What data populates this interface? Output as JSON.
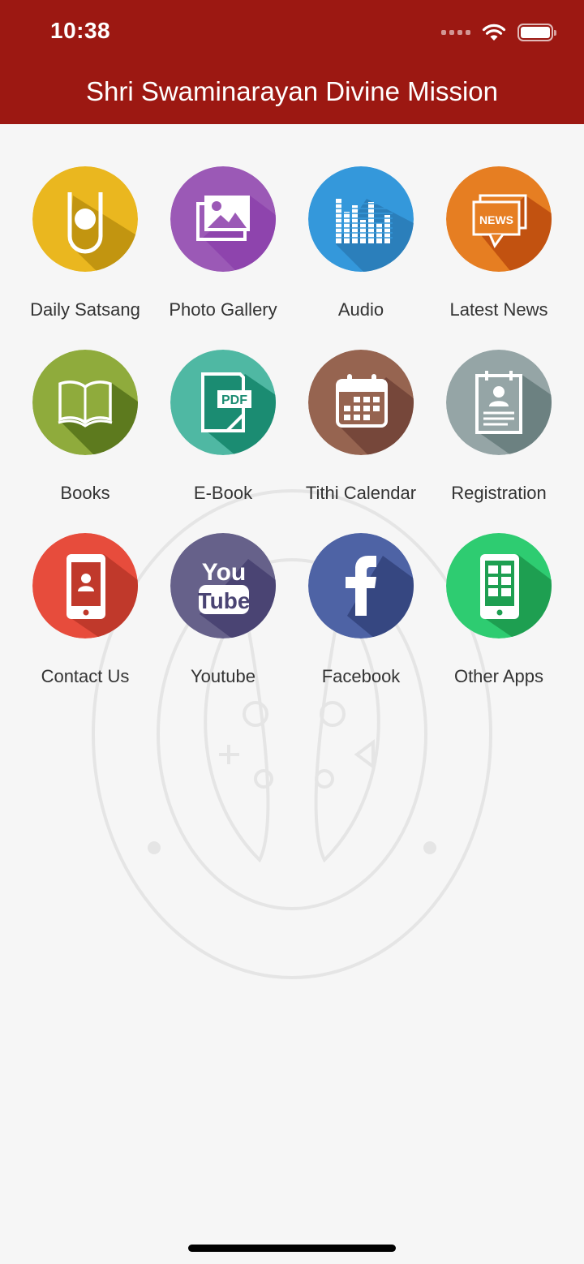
{
  "status_bar": {
    "time": "10:38"
  },
  "header": {
    "title": "Shri Swaminarayan Divine Mission"
  },
  "tiles": [
    {
      "label": "Daily Satsang",
      "icon": "tilak-icon",
      "color": "#eab71f",
      "shadow": "#c29510"
    },
    {
      "label": "Photo Gallery",
      "icon": "gallery-icon",
      "color": "#9b59b6",
      "shadow": "#8e44ad"
    },
    {
      "label": "Audio",
      "icon": "equalizer-icon",
      "color": "#3498db",
      "shadow": "#2b7fbb"
    },
    {
      "label": "Latest News",
      "icon": "news-icon",
      "color": "#e67e22",
      "shadow": "#c25210",
      "icon_text": "NEWS"
    },
    {
      "label": "Books",
      "icon": "book-icon",
      "color": "#8fab3c",
      "shadow": "#5d7a1e"
    },
    {
      "label": "E-Book",
      "icon": "pdf-icon",
      "color": "#4fb8a3",
      "shadow": "#1b8c72",
      "icon_text": "PDF"
    },
    {
      "label": "Tithi Calendar",
      "icon": "calendar-icon",
      "color": "#966450",
      "shadow": "#76473a"
    },
    {
      "label": "Registration",
      "icon": "registration-icon",
      "color": "#95a5a6",
      "shadow": "#6c8181"
    },
    {
      "label": "Contact Us",
      "icon": "phone-contact-icon",
      "color": "#e74c3c",
      "shadow": "#c0392b"
    },
    {
      "label": "Youtube",
      "icon": "youtube-icon",
      "color": "#66618a",
      "shadow": "#4a4473",
      "icon_text_top": "You",
      "icon_text_bottom": "Tube"
    },
    {
      "label": "Facebook",
      "icon": "facebook-icon",
      "color": "#4e63a5",
      "shadow": "#364781"
    },
    {
      "label": "Other Apps",
      "icon": "apps-phone-icon",
      "color": "#2ecc71",
      "shadow": "#1e9f51"
    }
  ]
}
